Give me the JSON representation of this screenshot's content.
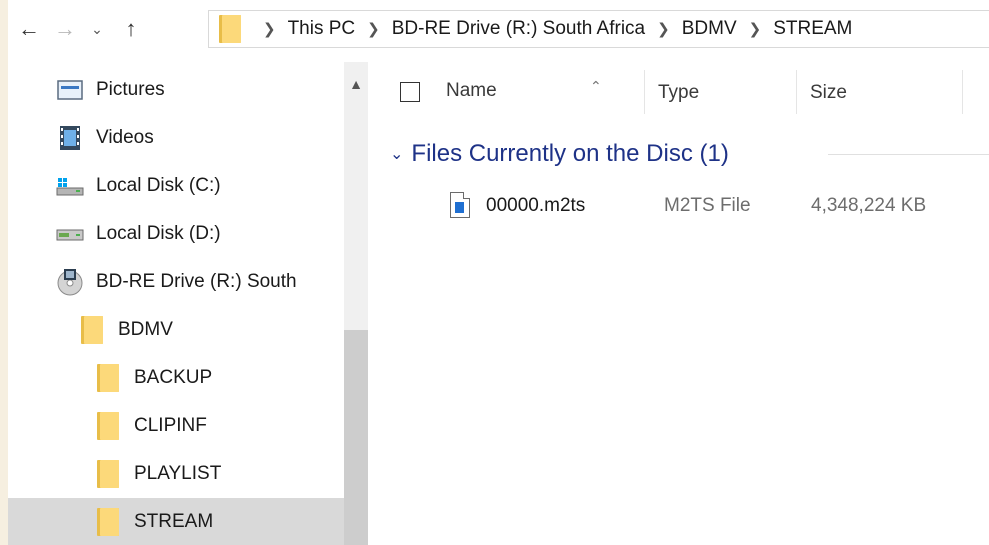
{
  "nav": {
    "back_icon": "back-arrow-icon",
    "forward_icon": "forward-arrow-icon",
    "recent_icon": "chevron-down-icon",
    "up_icon": "up-arrow-icon"
  },
  "address": {
    "segments": [
      "This PC",
      "BD-RE Drive (R:) South Africa",
      "BDMV",
      "STREAM"
    ]
  },
  "tree": {
    "items": [
      {
        "label": "Pictures",
        "icon": "pictures-icon"
      },
      {
        "label": "Videos",
        "icon": "videos-icon"
      },
      {
        "label": "Local Disk (C:)",
        "icon": "drive-c-icon"
      },
      {
        "label": "Local Disk (D:)",
        "icon": "drive-d-icon"
      },
      {
        "label": "BD-RE Drive (R:) South",
        "icon": "bd-drive-icon"
      },
      {
        "label": "BDMV",
        "icon": "folder-icon"
      },
      {
        "label": "BACKUP",
        "icon": "folder-icon"
      },
      {
        "label": "CLIPINF",
        "icon": "folder-icon"
      },
      {
        "label": "PLAYLIST",
        "icon": "folder-icon"
      },
      {
        "label": "STREAM",
        "icon": "folder-icon",
        "selected": true
      }
    ]
  },
  "columns": {
    "name": "Name",
    "type": "Type",
    "size": "Size"
  },
  "group": {
    "title": "Files Currently on the Disc (1)"
  },
  "files": [
    {
      "name": "00000.m2ts",
      "type": "M2TS File",
      "size": "4,348,224 KB"
    }
  ],
  "colors": {
    "group_header": "#1e3287",
    "selection": "#d9d9d9",
    "folder_yellow": "#fcd97a"
  }
}
